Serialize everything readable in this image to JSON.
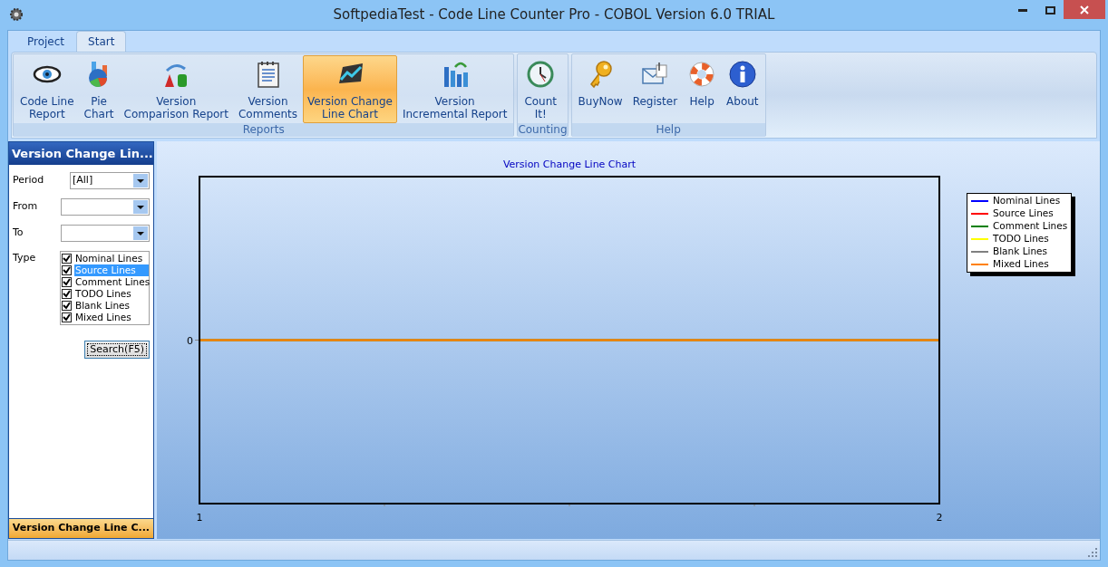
{
  "window": {
    "title": "SoftpediaTest - Code Line Counter Pro - COBOL Version 6.0 TRIAL"
  },
  "tabs": [
    {
      "label": "Project",
      "selected": false
    },
    {
      "label": "Start",
      "selected": true
    }
  ],
  "ribbon_groups": [
    {
      "label": "Reports",
      "buttons": [
        {
          "label": "Code Line\nReport",
          "selected": false
        },
        {
          "label": "Pie\nChart",
          "selected": false
        },
        {
          "label": "Version\nComparison Report",
          "selected": false
        },
        {
          "label": "Version\nComments",
          "selected": false
        },
        {
          "label": "Version Change\nLine Chart",
          "selected": true
        },
        {
          "label": "Version\nIncremental Report",
          "selected": false
        }
      ]
    },
    {
      "label": "Counting",
      "buttons": [
        {
          "label": "Count\nIt!",
          "selected": false
        }
      ]
    },
    {
      "label": "Help",
      "buttons": [
        {
          "label": "BuyNow",
          "selected": false
        },
        {
          "label": "Register",
          "selected": false
        },
        {
          "label": "Help",
          "selected": false
        },
        {
          "label": "About",
          "selected": false
        }
      ]
    }
  ],
  "panel": {
    "title": "Version Change Lin...",
    "fields": [
      {
        "label": "Period",
        "value": "[All]"
      },
      {
        "label": "From"
      },
      {
        "label": "To"
      }
    ],
    "type_label": "Type",
    "types": [
      {
        "label": "Nominal Lines",
        "checked": true,
        "selected": false
      },
      {
        "label": "Source Lines",
        "checked": true,
        "selected": true
      },
      {
        "label": "Comment Lines",
        "checked": true,
        "selected": false
      },
      {
        "label": "TODO Lines",
        "checked": true,
        "selected": false
      },
      {
        "label": "Blank Lines",
        "checked": true,
        "selected": false
      },
      {
        "label": "Mixed Lines",
        "checked": true,
        "selected": false
      }
    ],
    "search_button": "Search(F5)",
    "footer_tab": "Version Change Line C..."
  },
  "chart": {
    "title": "Version Change Line Chart",
    "y_axis_label": "0",
    "x_labels": [
      "1",
      "2"
    ],
    "legend": [
      {
        "name": "Nominal Lines",
        "color": "#0000ff"
      },
      {
        "name": "Source Lines",
        "color": "#ff0000"
      },
      {
        "name": "Comment Lines",
        "color": "#008000"
      },
      {
        "name": "TODO Lines",
        "color": "#ffff00"
      },
      {
        "name": "Blank Lines",
        "color": "#808080"
      },
      {
        "name": "Mixed Lines",
        "color": "#ff8000"
      }
    ]
  }
}
